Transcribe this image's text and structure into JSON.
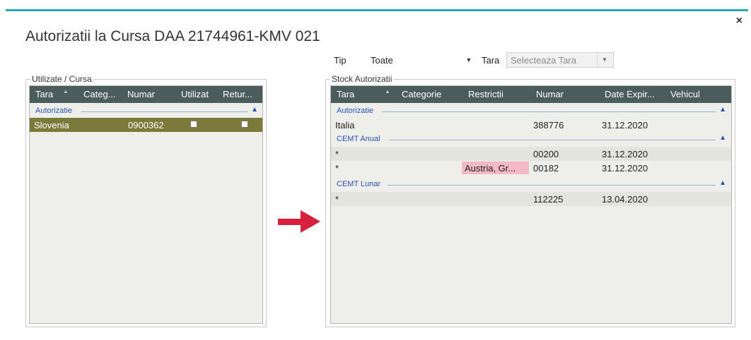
{
  "window": {
    "title": "Autorizatii la Cursa DAA 21744961-KMV 021",
    "close_glyph": "×"
  },
  "filters": {
    "tip_label": "Tip",
    "tip_value": "Toate",
    "tara_label": "Tara",
    "tara_placeholder": "Selecteaza Tara"
  },
  "left_panel": {
    "label": "Utilizate / Cursa",
    "columns": [
      "Tara",
      "Categ...",
      "Numar",
      "Utilizat",
      "Retur..."
    ],
    "group": "Autorizatie",
    "row": {
      "tara": "Slovenia",
      "numar": "0900362",
      "utilizat": false,
      "returnat": false
    },
    "selected_row_color": "#7b7a3a"
  },
  "right_panel": {
    "label": "Stock Autorizatii",
    "columns": [
      "Tara",
      "Categorie",
      "Restrictii",
      "Numar",
      "Date Expir...",
      "Vehicul"
    ],
    "groups": [
      {
        "name": "Autorizatie",
        "rows": [
          {
            "tara": "Italia",
            "restrictii": "",
            "numar": "388776",
            "date": "31.12.2020"
          }
        ]
      },
      {
        "name": "CEMT Anual",
        "rows": [
          {
            "tara": "*",
            "restrictii": "",
            "numar": "00200",
            "date": "31.12.2020"
          },
          {
            "tara": "*",
            "restrictii": "Austria, Gr...",
            "numar": "00182",
            "date": "31.12.2020"
          }
        ]
      },
      {
        "name": "CEMT Lunar",
        "rows": [
          {
            "tara": "*",
            "restrictii": "",
            "numar": "112225",
            "date": "13.04.2020"
          }
        ]
      }
    ],
    "restriction_color": "#f4b8c6"
  },
  "colors": {
    "header_bg": "#4a5d5a",
    "accent_top": "#2aa7b0",
    "arrow": "#d8203f"
  },
  "icons": {
    "sort": "triangle-up-icon",
    "collapse": "chevron-up-icon",
    "arrow": "arrow-right-icon"
  }
}
